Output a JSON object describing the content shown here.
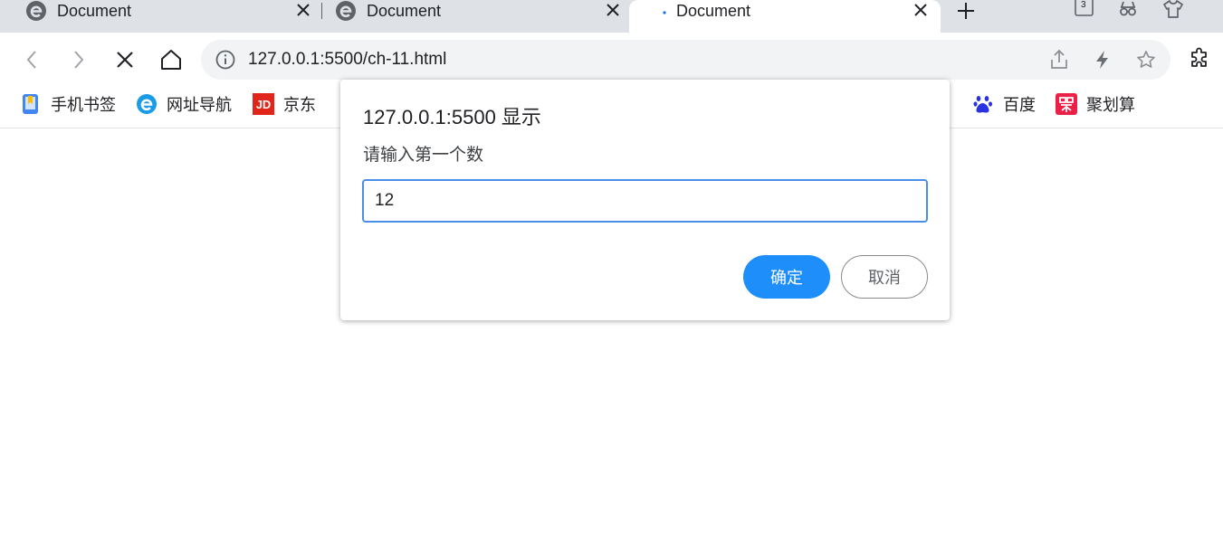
{
  "tabs": [
    {
      "title": "Document",
      "active": false
    },
    {
      "title": "Document",
      "active": false
    },
    {
      "title": "Document",
      "active": true
    }
  ],
  "strip_icons": {
    "tab_count": "3"
  },
  "toolbar": {
    "url": "127.0.0.1:5500/ch-11.html"
  },
  "bookmarks": [
    {
      "label": "手机书签",
      "icon": "phone-bookmark-icon"
    },
    {
      "label": "网址导航",
      "icon": "browser-e-icon"
    },
    {
      "label": "京东",
      "icon": "jd-icon"
    },
    {
      "label": "百度",
      "icon": "baidu-paw-icon"
    },
    {
      "label": "聚划算",
      "icon": "juhuasuan-icon"
    }
  ],
  "dialog": {
    "title": "127.0.0.1:5500 显示",
    "message": "请输入第一个数",
    "input_value": "12",
    "ok_label": "确定",
    "cancel_label": "取消"
  },
  "colors": {
    "tab_strip": "#dee1e6",
    "omnibox": "#f1f3f4",
    "accent": "#1d8efa",
    "input_border": "#4a8fe7"
  }
}
